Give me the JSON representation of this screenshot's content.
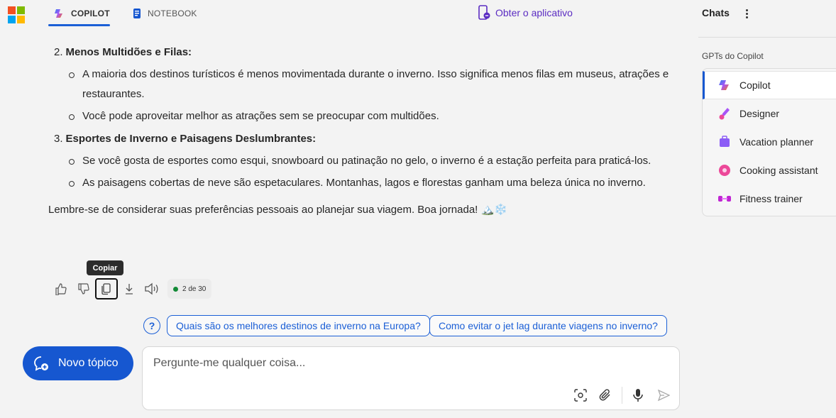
{
  "header": {
    "tabs": [
      {
        "label": "COPILOT"
      },
      {
        "label": "NOTEBOOK"
      }
    ],
    "get_app_label": "Obter o aplicativo"
  },
  "message": {
    "items": [
      {
        "number": "2.",
        "title": "Menos Multidões e Filas:",
        "bullets": [
          "A maioria dos destinos turísticos é menos movimentada durante o inverno. Isso significa menos filas em museus, atrações e restaurantes.",
          "Você pode aproveitar melhor as atrações sem se preocupar com multidões."
        ]
      },
      {
        "number": "3.",
        "title": "Esportes de Inverno e Paisagens Deslumbrantes:",
        "bullets": [
          "Se você gosta de esportes como esqui, snowboard ou patinação no gelo, o inverno é a estação perfeita para praticá-los.",
          "As paisagens cobertas de neve são espetaculares. Montanhas, lagos e florestas ganham uma beleza única no inverno."
        ]
      }
    ],
    "closing": "Lembre-se de considerar suas preferências pessoais ao planejar sua viagem. Boa jornada! 🏔️❄️"
  },
  "actions": {
    "tooltip": "Copiar",
    "counter": "2 de 30"
  },
  "suggestions": [
    "Quais são os melhores destinos de inverno na Europa?",
    "Como evitar o jet lag durante viagens no inverno?"
  ],
  "new_topic_label": "Novo tópico",
  "input": {
    "placeholder": "Pergunte-me qualquer coisa..."
  },
  "sidebar": {
    "title": "Chats",
    "gpts_title": "GPTs do Copilot",
    "gpts": [
      {
        "label": "Copilot",
        "icon": "copilot-icon",
        "color": "#3b82f6"
      },
      {
        "label": "Designer",
        "icon": "designer-icon",
        "color": "#a855f7"
      },
      {
        "label": "Vacation planner",
        "icon": "vacation-planner-icon",
        "color": "#8b5cf6"
      },
      {
        "label": "Cooking assistant",
        "icon": "cooking-assistant-icon",
        "color": "#ec4899"
      },
      {
        "label": "Fitness trainer",
        "icon": "fitness-trainer-icon",
        "color": "#c026d3"
      }
    ]
  },
  "colors": {
    "accent": "#1657d0",
    "brand_purple": "#5b2cc2",
    "status_green": "#138a36"
  }
}
